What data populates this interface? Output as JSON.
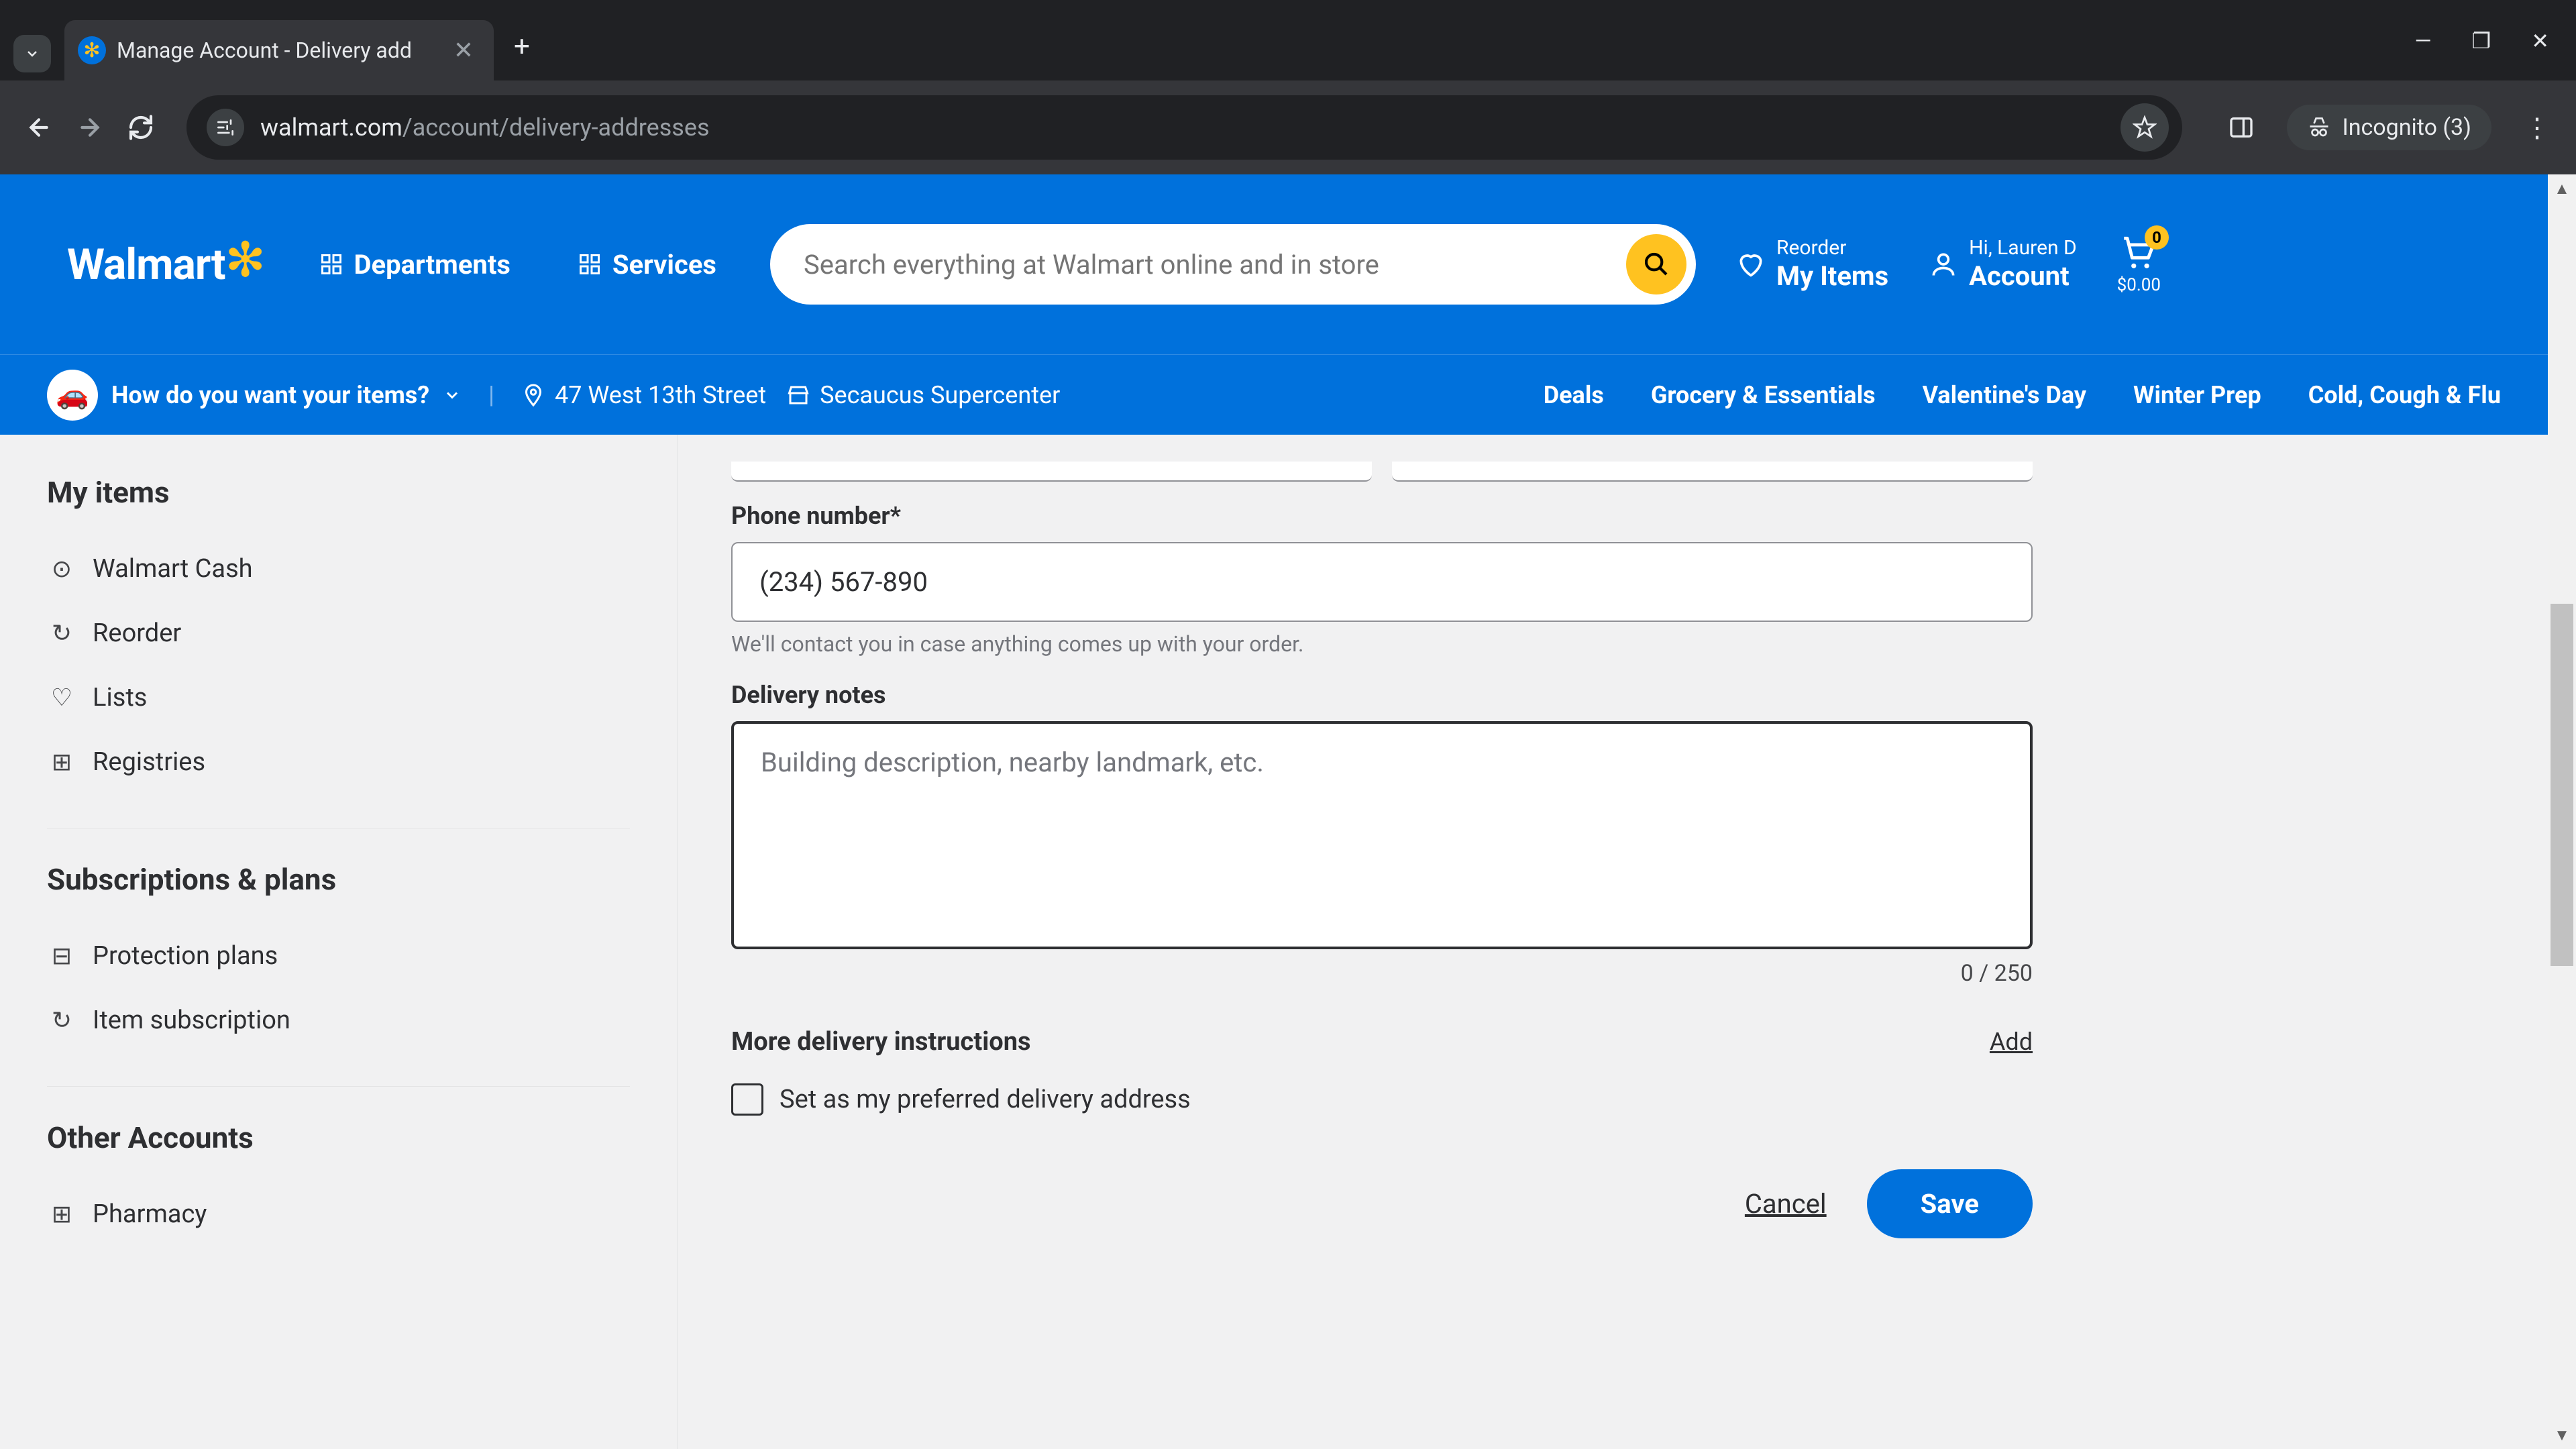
{
  "browser": {
    "tab_title": "Manage Account - Delivery add",
    "url_domain": "walmart.com",
    "url_path": "/account/delivery-addresses",
    "incognito_label": "Incognito (3)"
  },
  "header": {
    "logo_text": "Walmart",
    "departments": "Departments",
    "services": "Services",
    "search_placeholder": "Search everything at Walmart online and in store",
    "reorder_top": "Reorder",
    "reorder_bottom": "My Items",
    "account_top": "Hi, Lauren D",
    "account_bottom": "Account",
    "cart_count": "0",
    "cart_price": "$0.00"
  },
  "subheader": {
    "intent_label": "How do you want your items?",
    "address": "47 West 13th Street",
    "store": "Secaucus Supercenter",
    "links": [
      "Deals",
      "Grocery & Essentials",
      "Valentine's Day",
      "Winter Prep",
      "Cold, Cough & Flu"
    ]
  },
  "sidebar": {
    "section1_heading": "My items",
    "section1_items": [
      {
        "icon": "⊙",
        "label": "Walmart Cash"
      },
      {
        "icon": "↻",
        "label": "Reorder"
      },
      {
        "icon": "♡",
        "label": "Lists"
      },
      {
        "icon": "⊞",
        "label": "Registries"
      }
    ],
    "section2_heading": "Subscriptions & plans",
    "section2_items": [
      {
        "icon": "⊟",
        "label": "Protection plans"
      },
      {
        "icon": "↻",
        "label": "Item subscription"
      }
    ],
    "section3_heading": "Other Accounts",
    "section3_items": [
      {
        "icon": "⊞",
        "label": "Pharmacy"
      }
    ]
  },
  "form": {
    "phone_label": "Phone number*",
    "phone_value": "(234) 567-890",
    "phone_hint": "We'll contact you in case anything comes up with your order.",
    "notes_label": "Delivery notes",
    "notes_placeholder": "Building description, nearby landmark, etc.",
    "char_count": "0 / 250",
    "more_label": "More delivery instructions",
    "add_link": "Add",
    "checkbox_label": "Set as my preferred delivery address",
    "cancel": "Cancel",
    "save": "Save"
  }
}
